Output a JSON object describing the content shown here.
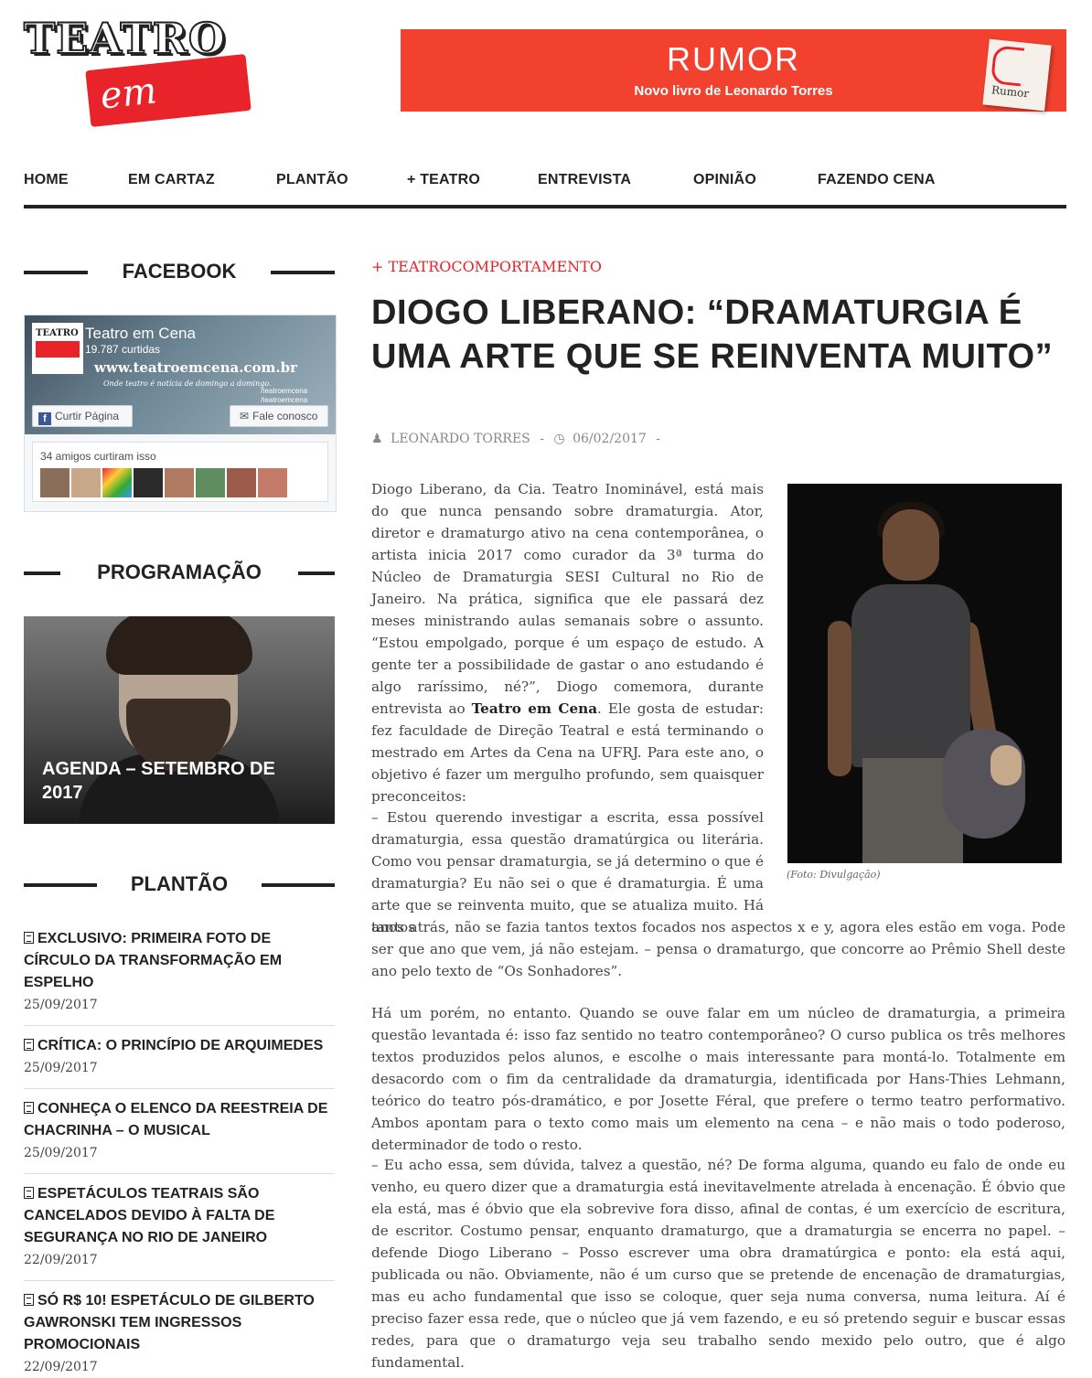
{
  "logo": {
    "line1": "TEATRO",
    "line2": "em cena"
  },
  "banner": {
    "title": "RUMOR",
    "subtitle": "Novo livro de Leonardo Torres",
    "book_label": "Rumor"
  },
  "nav": {
    "items": [
      "HOME",
      "EM CARTAZ",
      "PLANTÃO",
      "+ TEATRO",
      "ENTREVISTA",
      "OPINIÃO",
      "FAZENDO CENA"
    ]
  },
  "sidebar": {
    "facebook": {
      "heading": "FACEBOOK",
      "page_name": "Teatro em Cena",
      "likes": "19.787 curtidas",
      "cover_url": "www.teatroemcena.com.br",
      "cover_tagline": "Onde teatro é notícia de domingo a domingo.",
      "handles": [
        "/teatroemcena",
        "/teatroemcena"
      ],
      "like_button": "Curtir Página",
      "message_button": "Fale conosco",
      "friends_text": "34 amigos curtiram isso"
    },
    "programacao": {
      "heading": "PROGRAMAÇÃO",
      "caption": "AGENDA – SETEMBRO DE 2017"
    },
    "plantao": {
      "heading": "PLANTÃO",
      "items": [
        {
          "title": "EXCLUSIVO: PRIMEIRA FOTO DE CÍRCULO DA TRANSFORMAÇÃO EM ESPELHO",
          "date": "25/09/2017"
        },
        {
          "title": "CRÍTICA: O PRINCÍPIO DE ARQUIMEDES",
          "date": "25/09/2017"
        },
        {
          "title": "CONHEÇA O ELENCO DA REESTREIA DE CHACRINHA – O MUSICAL",
          "date": "25/09/2017"
        },
        {
          "title": "ESPETÁCULOS TEATRAIS SÃO CANCELADOS DEVIDO À FALTA DE SEGURANÇA NO RIO DE JANEIRO",
          "date": "22/09/2017"
        },
        {
          "title": "SÓ R$ 10! ESPETÁCULO DE GILBERTO GAWRONSKI TEM INGRESSOS PROMOCIONAIS",
          "date": "22/09/2017"
        }
      ]
    }
  },
  "article": {
    "category": "+ TEATROCOMPORTAMENTO",
    "title": "DIOGO LIBERANO: “DRAMATURGIA É UMA ARTE QUE SE REINVENTA MUITO”",
    "author": "LEONARDO TORRES",
    "date": "06/02/2017",
    "photo_caption": "(Foto: Divulgação)",
    "p1a": "Diogo Liberano, da Cia. Teatro Inominável, está mais do que nunca pensando sobre dramaturgia. Ator, diretor e dramaturgo ativo na cena contemporânea, o artista inicia 2017 como curador da 3ª turma do Núcleo de Dramaturgia SESI Cultural no Rio de Janeiro. Na prática, significa que ele passará dez meses ministrando aulas semanais sobre o assunto. “Estou empolgado, porque é um espaço de estudo. A gente ter a possibilidade de gastar o ano estudando é algo raríssimo, né?”, Diogo comemora, durante entrevista ao ",
    "p1b": "Teatro em Cena",
    "p1c": ". Ele gosta de estudar: fez faculdade de Direção Teatral e está terminando o mestrado em Artes da Cena na UFRJ. Para este ano, o objetivo é fazer um mergulho profundo, sem quaisquer preconceitos:",
    "p2": "– Estou querendo investigar a escrita, essa possível dramaturgia, essa questão dramatúrgica ou literária. Como vou pensar dramaturgia, se já determino o que é dramaturgia? Eu não sei o que é dramaturgia. É uma arte que se reinventa muito, que se atualiza muito. Há tantos",
    "p2b": "anos atrás, não se fazia tantos textos focados nos aspectos x e y, agora eles estão em voga. Pode ser que ano que vem, já não estejam. – pensa o dramaturgo, que concorre ao Prêmio Shell deste ano pelo texto de “Os Sonhadores”.",
    "p3": "Há um porém, no entanto. Quando se ouve falar em um núcleo de dramaturgia, a primeira questão levantada é: isso faz sentido no teatro contemporâneo? O curso publica os três melhores textos produzidos pelos alunos, e escolhe o mais interessante para montá-lo. Totalmente em desacordo com o fim da centralidade da dramaturgia, identificada por Hans-Thies Lehmann, teórico do teatro pós-dramático, e por Josette Féral, que prefere o termo teatro performativo. Ambos apontam para o texto como mais um elemento na cena – e não mais o todo poderoso, determinador de todo o resto.",
    "p4": "– Eu acho essa, sem dúvida, talvez a questão, né? De forma alguma, quando eu falo de onde eu venho, eu quero dizer que a dramaturgia está inevitavelmente atrelada à encenação. É óbvio que ela está, mas é óbvio que ela sobrevive fora disso, afinal de contas, é um exercício de escritura, de escritor. Costumo pensar, enquanto dramaturgo, que a dramaturgia se encerra no papel. – defende Diogo Liberano – Posso escrever uma obra dramatúrgica e ponto: ela está aqui, publicada ou não. Obviamente, não é um curso que se pretende de encenação de dramaturgias, mas eu acho fundamental que isso se coloque, quer seja numa conversa, numa leitura. Aí é preciso fazer essa rede, que o núcleo que já vem fazendo, e eu só pretendo seguir e buscar essas redes, para que o dramaturgo veja seu trabalho sendo mexido pelo outro, que é algo fundamental."
  }
}
